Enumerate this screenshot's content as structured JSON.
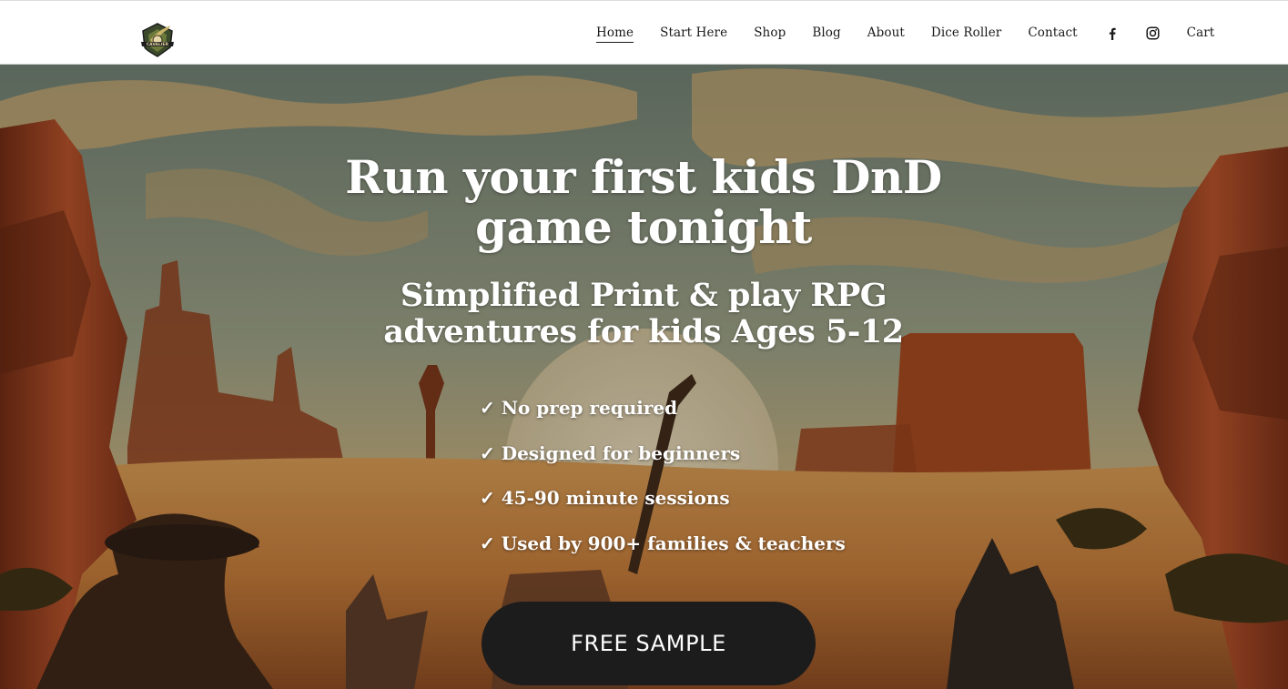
{
  "header": {
    "logo_text": "CAVALIER",
    "nav": [
      {
        "label": "Home",
        "active": true
      },
      {
        "label": "Start Here",
        "active": false
      },
      {
        "label": "Shop",
        "active": false
      },
      {
        "label": "Blog",
        "active": false
      },
      {
        "label": "About",
        "active": false
      },
      {
        "label": "Dice Roller",
        "active": false
      },
      {
        "label": "Contact",
        "active": false
      }
    ],
    "social_icons": [
      "facebook-icon",
      "instagram-icon"
    ],
    "cart_label": "Cart"
  },
  "hero": {
    "title": "Run your first kids DnD game tonight",
    "subtitle": "Simplified Print & play RPG adventures for kids Ages 5-12",
    "features": [
      "✓ No prep required",
      "✓ Designed for beginners",
      "✓ 45-90 minute sessions",
      "✓ Used by 900+ families & teachers"
    ],
    "cta_label": "FREE SAMPLE"
  },
  "colors": {
    "header_bg": "#ffffff",
    "nav_text": "#1a1a1a",
    "hero_text": "#ffffff",
    "cta_bg": "#1c1c1c",
    "cta_text": "#ffffff",
    "sky": "#7c8b7c",
    "desert": "#c87a3a",
    "rock": "#9a3a1e"
  }
}
